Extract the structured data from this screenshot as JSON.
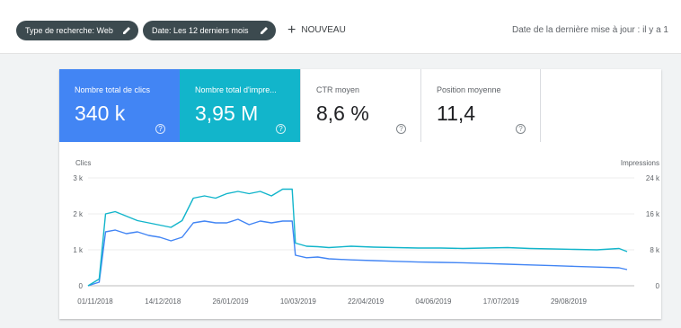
{
  "filters": {
    "search_type": "Type de recherche: Web",
    "date": "Date: Les 12 derniers mois",
    "new_label": "NOUVEAU"
  },
  "last_updated": "Date de la dernière mise à jour : il y a 1",
  "metrics": {
    "clicks": {
      "label": "Nombre total de clics",
      "value": "340 k"
    },
    "impressions": {
      "label": "Nombre total d'impre...",
      "value": "3,95 M"
    },
    "ctr": {
      "label": "CTR moyen",
      "value": "8,6 %"
    },
    "position": {
      "label": "Position moyenne",
      "value": "11,4"
    }
  },
  "colors": {
    "clicks": "#4285f4",
    "impressions": "#12b5cb",
    "chip": "#3c4a4f"
  },
  "icons": {
    "edit": "pencil-icon",
    "help": "help-circle-icon",
    "add": "plus-icon"
  },
  "chart_data": {
    "type": "line",
    "ylabel": "Clics",
    "y2label": "Impressions",
    "ylim": [
      0,
      3000
    ],
    "y2lim": [
      0,
      24000
    ],
    "y_ticks": [
      "0",
      "1 k",
      "2 k",
      "3 k"
    ],
    "y2_ticks": [
      "0",
      "8 k",
      "16 k",
      "24 k"
    ],
    "x_ticks": [
      "01/11/2018",
      "14/12/2018",
      "26/01/2019",
      "10/03/2019",
      "22/04/2019",
      "04/06/2019",
      "17/07/2019",
      "29/08/2019"
    ],
    "x_start": "2018-11-01",
    "x_end": "2019-10-05",
    "grid": true,
    "series": [
      {
        "name": "Clics",
        "axis": "left",
        "color": "#4285f4",
        "dates": [
          "2018-11-01",
          "2018-11-08",
          "2018-11-12",
          "2018-11-18",
          "2018-11-25",
          "2018-12-02",
          "2018-12-09",
          "2018-12-16",
          "2018-12-23",
          "2018-12-30",
          "2019-01-06",
          "2019-01-13",
          "2019-01-20",
          "2019-01-27",
          "2019-02-03",
          "2019-02-10",
          "2019-02-17",
          "2019-02-24",
          "2019-03-03",
          "2019-03-09",
          "2019-03-11",
          "2019-03-18",
          "2019-03-25",
          "2019-04-01",
          "2019-04-15",
          "2019-04-29",
          "2019-05-13",
          "2019-05-27",
          "2019-06-10",
          "2019-06-24",
          "2019-07-08",
          "2019-07-22",
          "2019-08-05",
          "2019-08-19",
          "2019-09-02",
          "2019-09-16",
          "2019-09-30",
          "2019-10-05"
        ],
        "values": [
          0,
          100,
          1500,
          1550,
          1450,
          1500,
          1400,
          1350,
          1250,
          1350,
          1750,
          1800,
          1750,
          1750,
          1850,
          1700,
          1800,
          1750,
          1800,
          1800,
          850,
          780,
          800,
          750,
          720,
          700,
          680,
          660,
          650,
          640,
          620,
          600,
          580,
          560,
          540,
          520,
          500,
          450
        ]
      },
      {
        "name": "Impressions",
        "axis": "right",
        "color": "#12b5cb",
        "dates": [
          "2018-11-01",
          "2018-11-08",
          "2018-11-12",
          "2018-11-18",
          "2018-11-25",
          "2018-12-02",
          "2018-12-09",
          "2018-12-16",
          "2018-12-23",
          "2018-12-30",
          "2019-01-06",
          "2019-01-13",
          "2019-01-20",
          "2019-01-27",
          "2019-02-03",
          "2019-02-10",
          "2019-02-17",
          "2019-02-24",
          "2019-03-03",
          "2019-03-09",
          "2019-03-11",
          "2019-03-18",
          "2019-03-25",
          "2019-04-01",
          "2019-04-15",
          "2019-04-29",
          "2019-05-13",
          "2019-05-27",
          "2019-06-10",
          "2019-06-24",
          "2019-07-08",
          "2019-07-22",
          "2019-08-05",
          "2019-08-19",
          "2019-09-02",
          "2019-09-16",
          "2019-09-30",
          "2019-10-05"
        ],
        "values": [
          0,
          1500,
          16000,
          16500,
          15500,
          14500,
          14000,
          13500,
          13000,
          14500,
          19500,
          20000,
          19500,
          20500,
          21000,
          20500,
          21000,
          20000,
          21500,
          21500,
          9500,
          8800,
          8700,
          8500,
          8800,
          8600,
          8500,
          8400,
          8400,
          8300,
          8400,
          8500,
          8300,
          8200,
          8100,
          8000,
          8300,
          7600
        ]
      }
    ]
  }
}
